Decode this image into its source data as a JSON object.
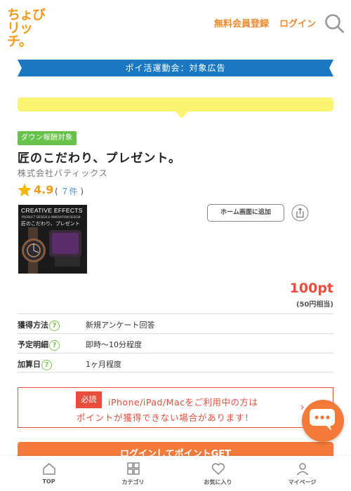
{
  "header": {
    "logo_line1": "ちょび",
    "logo_line2": "リッチ。",
    "register_label": "無料会員登録",
    "login_label": "ログイン"
  },
  "banner": {
    "text": "ポイ活運動会：対象広告"
  },
  "ad": {
    "badge": "ダウン報酬対象",
    "title": "匠のこだわり、プレゼント。",
    "company": "株式会社バティックス",
    "rating": "4.9",
    "rating_open": "(",
    "rating_count": "７件",
    "rating_close": ")",
    "thumbnail": {
      "line1": "CREATIVE EFFECTS",
      "line2": "PRODUCT DESIGN & INNOVATION DESIGN",
      "line3": "匠のこだわり、プレゼント"
    },
    "home_button": "ホーム画面に追加",
    "points": "100pt",
    "points_sub": "(50円相当)"
  },
  "info_rows": [
    {
      "label": "獲得方法",
      "value": "新規アンケート回答"
    },
    {
      "label": "予定明細",
      "value": "即時～10分程度"
    },
    {
      "label": "加算日",
      "value": "1ヶ月程度"
    }
  ],
  "notice": {
    "required": "必読",
    "line1": "iPhone/iPad/Macをご利用中の方は",
    "line2": "ポイントが獲得できない場合があります！"
  },
  "login_button": "ログインしてポイントGET",
  "bottom_nav": [
    {
      "label": "TOP",
      "icon": "home-icon"
    },
    {
      "label": "カテゴリ",
      "icon": "category-icon"
    },
    {
      "label": "お気に入り",
      "icon": "heart-icon"
    },
    {
      "label": "マイページ",
      "icon": "user-icon"
    }
  ],
  "colors": {
    "accent": "#f08a2e",
    "banner": "#1a78c2",
    "balloon": "#fbf470",
    "badge_green": "#66c24a",
    "point_red": "#e94e3c",
    "cta": "#f47a3a"
  }
}
